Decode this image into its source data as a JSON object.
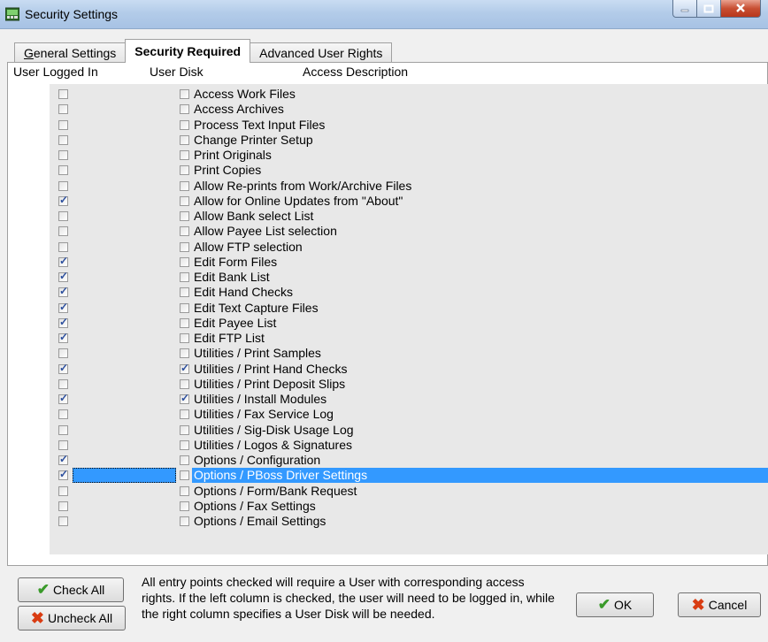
{
  "window": {
    "title": "Security Settings"
  },
  "tabs": [
    {
      "label_u": "G",
      "label_rest": "eneral Settings",
      "active": false
    },
    {
      "label": "Security Required",
      "active": true
    },
    {
      "label": "Advanced User Rights",
      "active": false
    }
  ],
  "columns": {
    "logged_in": "User Logged In",
    "user_disk": "User Disk",
    "access_description": "Access Description"
  },
  "rows": [
    {
      "label": "Access Work Files",
      "logged": false,
      "disk": false
    },
    {
      "label": "Access Archives",
      "logged": false,
      "disk": false
    },
    {
      "label": "Process Text Input Files",
      "logged": false,
      "disk": false
    },
    {
      "label": "Change Printer Setup",
      "logged": false,
      "disk": false
    },
    {
      "label": "Print Originals",
      "logged": false,
      "disk": false
    },
    {
      "label": "Print Copies",
      "logged": false,
      "disk": false
    },
    {
      "label": "Allow Re-prints from Work/Archive Files",
      "logged": false,
      "disk": false
    },
    {
      "label": "Allow for Online Updates from \"About\"",
      "logged": true,
      "disk": false
    },
    {
      "label": "Allow Bank select List",
      "logged": false,
      "disk": false
    },
    {
      "label": "Allow Payee List selection",
      "logged": false,
      "disk": false
    },
    {
      "label": "Allow FTP selection",
      "logged": false,
      "disk": false
    },
    {
      "label": "Edit Form Files",
      "logged": true,
      "disk": false
    },
    {
      "label": "Edit Bank List",
      "logged": true,
      "disk": false
    },
    {
      "label": "Edit Hand Checks",
      "logged": true,
      "disk": false
    },
    {
      "label": "Edit Text Capture Files",
      "logged": true,
      "disk": false
    },
    {
      "label": "Edit Payee List",
      "logged": true,
      "disk": false
    },
    {
      "label": "Edit FTP List",
      "logged": true,
      "disk": false
    },
    {
      "label": "Utilities / Print Samples",
      "logged": false,
      "disk": false
    },
    {
      "label": "Utilities / Print Hand Checks",
      "logged": true,
      "disk": true
    },
    {
      "label": "Utilities / Print Deposit Slips",
      "logged": false,
      "disk": false
    },
    {
      "label": "Utilities / Install Modules",
      "logged": true,
      "disk": true
    },
    {
      "label": "Utilities / Fax Service Log",
      "logged": false,
      "disk": false
    },
    {
      "label": "Utilities / Sig-Disk Usage Log",
      "logged": false,
      "disk": false
    },
    {
      "label": "Utilities / Logos & Signatures",
      "logged": false,
      "disk": false
    },
    {
      "label": "Options / Configuration",
      "logged": true,
      "disk": false
    },
    {
      "label": "Options / PBoss Driver Settings",
      "logged": true,
      "disk": false,
      "selected": true
    },
    {
      "label": "Options / Form/Bank Request",
      "logged": false,
      "disk": false
    },
    {
      "label": "Options / Fax Settings",
      "logged": false,
      "disk": false
    },
    {
      "label": "Options / Email Settings",
      "logged": false,
      "disk": false
    }
  ],
  "buttons": {
    "check_all": "Check All",
    "uncheck_all": "Uncheck All",
    "ok": "OK",
    "cancel": "Cancel"
  },
  "note": "All entry points checked will require a User with corresponding access rights.  If the left column is checked, the user will need to be logged in, while the right column specifies a User Disk will be needed.",
  "colors": {
    "selection": "#3399ff",
    "checkmark": "#2c4f9e"
  },
  "icons": {
    "check_all": "green-check-icon",
    "uncheck_all": "red-x-icon",
    "ok": "green-check-icon",
    "cancel": "red-x-icon"
  }
}
